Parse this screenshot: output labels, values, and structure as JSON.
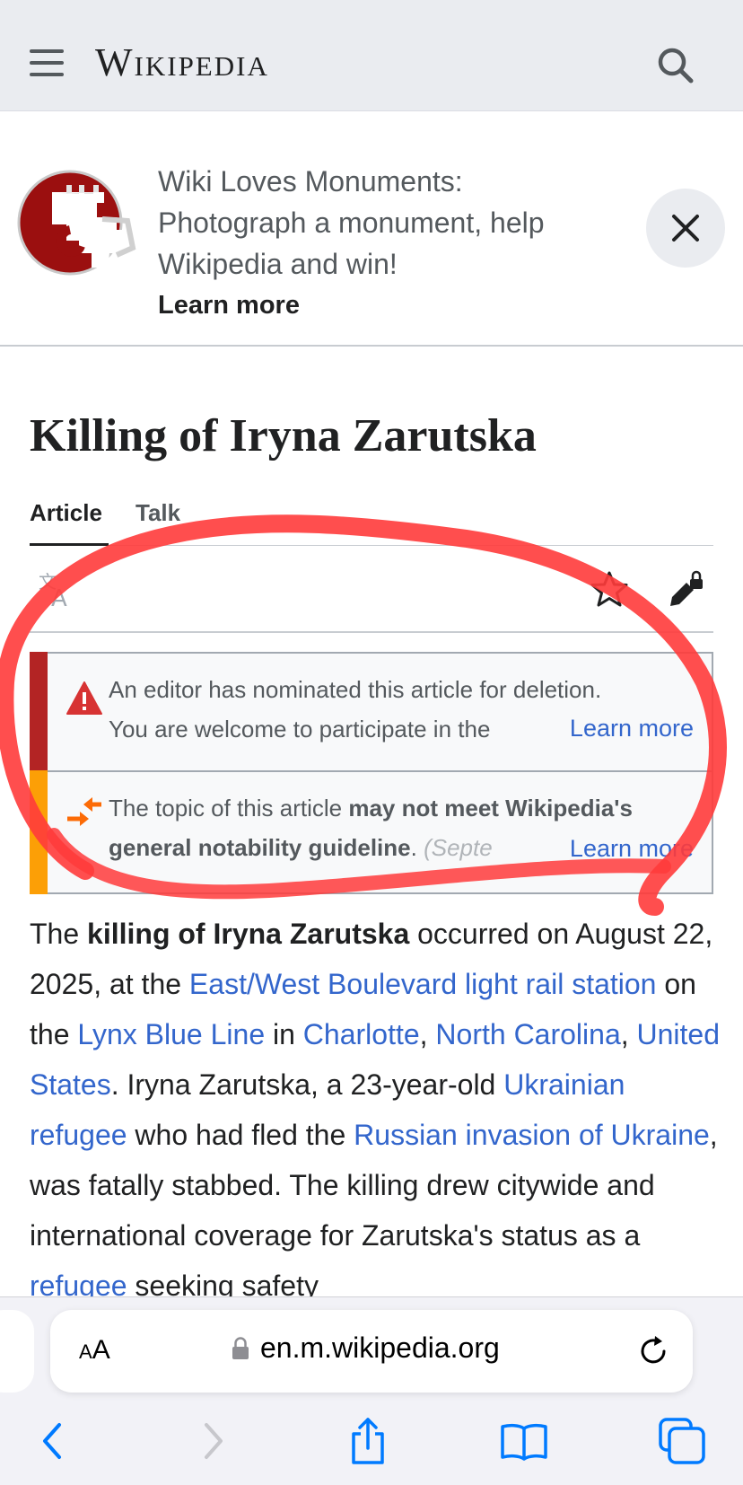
{
  "header": {
    "wordmark": "Wikipedia"
  },
  "banner": {
    "text": "Wiki Loves Monuments: Photograph a monument, help Wikipedia and win!",
    "learn_more": "Learn more"
  },
  "page": {
    "title": "Killing of Iryna Zarutska",
    "tabs": [
      "Article",
      "Talk"
    ]
  },
  "notices": [
    {
      "line1": "An editor has nominated this article for deletion.",
      "line2": "You are welcome to participate in the",
      "learn_more": "Learn more",
      "accent": "#b32424"
    },
    {
      "line1_a": "The topic of this article ",
      "line1_b": "may not meet Wikipedia's",
      "line2_a": "general notability guideline",
      "line2_b": ". ",
      "line2_c": "(Septe",
      "learn_more": "Learn more",
      "accent": "#fc9f06"
    }
  ],
  "article": {
    "p1": "The ",
    "p2": "killing of Iryna Zarutska",
    "p3": " occurred on August 22, 2025, at the ",
    "link1": "East/West Boulevard light rail station",
    "p4": " on the ",
    "link2": "Lynx Blue Line",
    "p5": " in ",
    "link3": "Charlotte",
    "p6": ", ",
    "link4": "North Carolina",
    "p7": ", ",
    "link5": "United States",
    "p8": ". Iryna Zarutska, a 23-year-old ",
    "link6": "Ukrainian refugee",
    "p9": " who had fled the ",
    "link7": "Russian invasion of Ukraine",
    "p10": ", was fatally stabbed. The killing drew citywide and international coverage for Zarutska's status as a ",
    "link8": "refugee",
    "p11": " seeking safety"
  },
  "browser": {
    "aa_label_small": "A",
    "aa_label_big": "A",
    "url": "en.m.wikipedia.org"
  },
  "colors": {
    "link": "#3366cc",
    "annotation": "#ff3b3b"
  }
}
